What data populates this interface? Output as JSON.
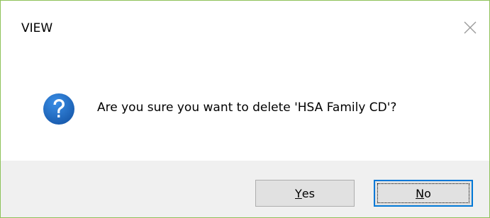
{
  "window": {
    "title": "VIEW"
  },
  "message": "Are you sure you want to delete 'HSA Family CD'?",
  "icons": {
    "close": "close-icon",
    "question": "question-icon"
  },
  "buttons": {
    "yes": {
      "mnemonic": "Y",
      "rest": "es"
    },
    "no": {
      "mnemonic": "N",
      "rest": "o"
    }
  },
  "colors": {
    "window_border": "#8ec25a",
    "question_icon": "#1f6bbd",
    "focus_border": "#0078d7",
    "footer_background": "#f0f0f0",
    "button_background": "#e1e1e1"
  }
}
